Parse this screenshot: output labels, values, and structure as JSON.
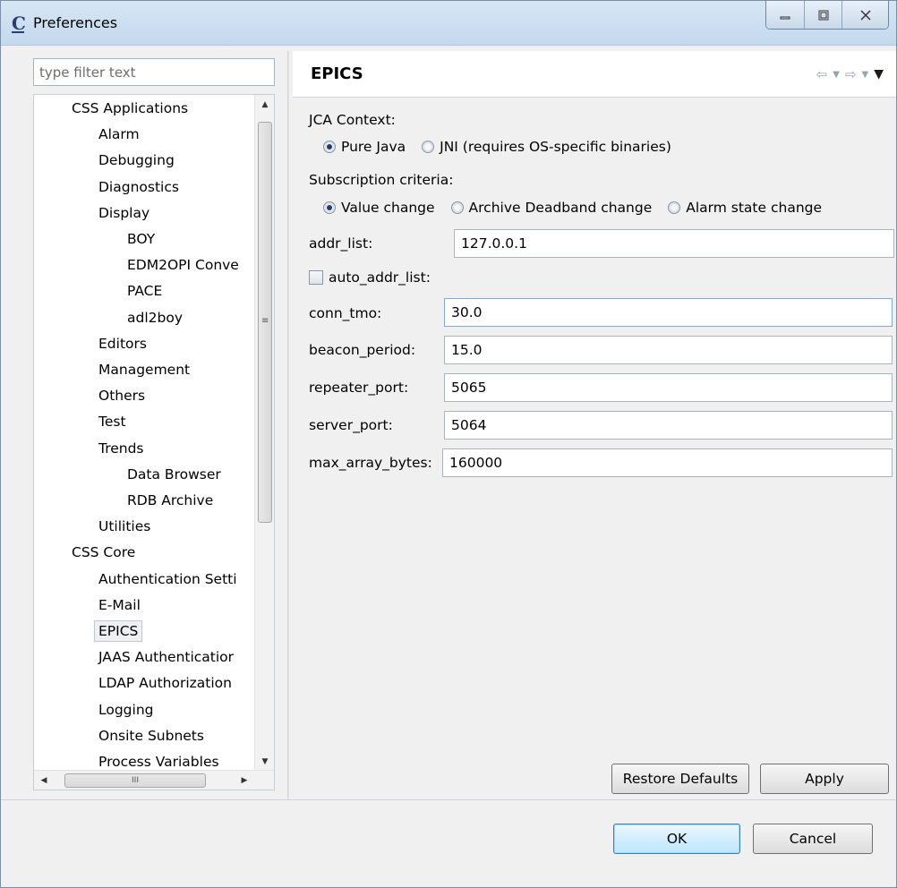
{
  "window": {
    "title": "Preferences",
    "app_icon": "C"
  },
  "filter": {
    "placeholder": "type filter text"
  },
  "tree": {
    "items": [
      {
        "label": "CSS Applications",
        "level": 0
      },
      {
        "label": "Alarm",
        "level": 1
      },
      {
        "label": "Debugging",
        "level": 1
      },
      {
        "label": "Diagnostics",
        "level": 1
      },
      {
        "label": "Display",
        "level": 1
      },
      {
        "label": "BOY",
        "level": 2
      },
      {
        "label": "EDM2OPI Conve",
        "level": 2
      },
      {
        "label": "PACE",
        "level": 2
      },
      {
        "label": "adl2boy",
        "level": 2
      },
      {
        "label": "Editors",
        "level": 1
      },
      {
        "label": "Management",
        "level": 1
      },
      {
        "label": "Others",
        "level": 1
      },
      {
        "label": "Test",
        "level": 1
      },
      {
        "label": "Trends",
        "level": 1
      },
      {
        "label": "Data Browser",
        "level": 2
      },
      {
        "label": "RDB Archive",
        "level": 2
      },
      {
        "label": "Utilities",
        "level": 1
      },
      {
        "label": "CSS Core",
        "level": 0
      },
      {
        "label": "Authentication Setti",
        "level": 1
      },
      {
        "label": "E-Mail",
        "level": 1
      },
      {
        "label": "EPICS",
        "level": 1,
        "selected": true
      },
      {
        "label": "JAAS Authenticatior",
        "level": 1
      },
      {
        "label": "LDAP Authorization",
        "level": 1
      },
      {
        "label": "Logging",
        "level": 1
      },
      {
        "label": "Onsite Subnets",
        "level": 1
      },
      {
        "label": "Process Variables",
        "level": 1
      }
    ],
    "hscroll_grip": "III",
    "vscroll_grip": "≡"
  },
  "page": {
    "title": "EPICS",
    "jca_context_label": "JCA Context:",
    "jca_options": [
      "Pure Java",
      "JNI (requires OS-specific binaries)"
    ],
    "jca_selected": 0,
    "subscription_label": "Subscription criteria:",
    "subscription_options": [
      "Value change",
      "Archive Deadband change",
      "Alarm state change"
    ],
    "subscription_selected": 0,
    "fields": {
      "addr_list": {
        "label": "addr_list:",
        "value": "127.0.0.1"
      },
      "auto_addr_list": {
        "label": "auto_addr_list:",
        "checked": false
      },
      "conn_tmo": {
        "label": "conn_tmo:",
        "value": "30.0"
      },
      "beacon_period": {
        "label": "beacon_period:",
        "value": "15.0"
      },
      "repeater_port": {
        "label": "repeater_port:",
        "value": "5065"
      },
      "server_port": {
        "label": "server_port:",
        "value": "5064"
      },
      "max_array_bytes": {
        "label": "max_array_bytes:",
        "value": "160000"
      }
    },
    "restore_defaults_label": "Restore Defaults",
    "apply_label": "Apply"
  },
  "dialog": {
    "ok_label": "OK",
    "cancel_label": "Cancel"
  },
  "colors": {
    "titlebar": "#c4d9ee",
    "radio_dot": "#1e3a78",
    "primary_button": "#bee6fd"
  }
}
